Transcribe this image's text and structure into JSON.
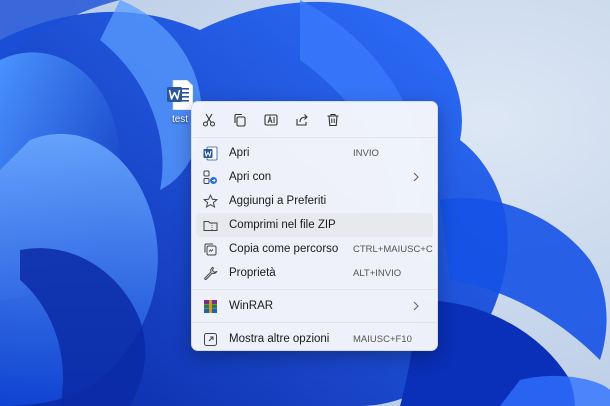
{
  "desktop": {
    "file_label": "test"
  },
  "context_menu": {
    "quick_actions": [
      {
        "icon": "cut-icon"
      },
      {
        "icon": "copy-icon"
      },
      {
        "icon": "rename-icon"
      },
      {
        "icon": "share-icon"
      },
      {
        "icon": "delete-icon"
      }
    ],
    "items": [
      {
        "label": "Apri",
        "shortcut": "INVIO",
        "icon": "word-icon"
      },
      {
        "label": "Apri con",
        "shortcut": "",
        "icon": "open-with-icon",
        "submenu": true
      },
      {
        "label": "Aggiungi a Preferiti",
        "shortcut": "",
        "icon": "star-icon"
      },
      {
        "label": "Comprimi nel file ZIP",
        "shortcut": "",
        "icon": "zip-folder-icon"
      },
      {
        "label": "Copia come percorso",
        "shortcut": "CTRL+MAIUSC+C",
        "icon": "copy-path-icon"
      },
      {
        "label": "Proprietà",
        "shortcut": "ALT+INVIO",
        "icon": "wrench-icon"
      },
      {
        "label": "WinRAR",
        "shortcut": "",
        "icon": "winrar-icon",
        "submenu": true
      },
      {
        "label": "Mostra altre opzioni",
        "shortcut": "MAIUSC+F10",
        "icon": "more-options-icon"
      }
    ]
  },
  "colors": {
    "wallpaper_bg": "#c7d6ea",
    "bloom_dark": "#0a2fb8",
    "bloom_mid": "#1552e6",
    "bloom_light": "#3f86ff",
    "word_blue": "#2b579a",
    "menu_bg": "#f6f7fb",
    "hover_bg": "#e7e9ef"
  }
}
